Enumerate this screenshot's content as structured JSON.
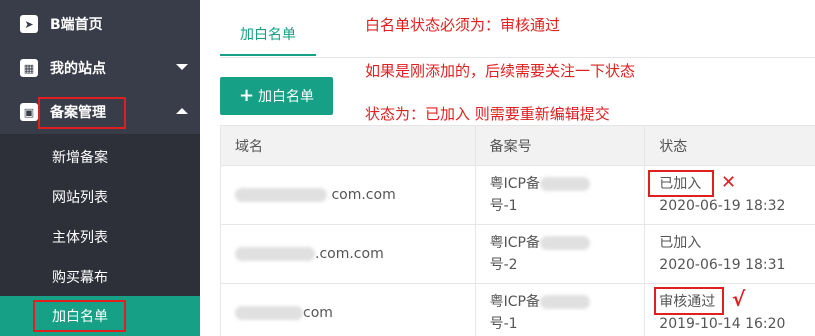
{
  "sidebar": {
    "items": [
      {
        "label": "B端首页",
        "icon": "send-icon"
      },
      {
        "label": "我的站点",
        "icon": "site-icon"
      },
      {
        "label": "备案管理",
        "icon": "gift-icon"
      }
    ],
    "sub_items": [
      "新增备案",
      "网站列表",
      "主体列表",
      "购买幕布",
      "加白名单"
    ]
  },
  "tab": {
    "label": "加白名单"
  },
  "add_button": {
    "label": "加白名单"
  },
  "notes": {
    "line1": "白名单状态必须为：审核通过",
    "line2": "如果是刚添加的，后续需要关注一下状态",
    "line3": "状态为：已加入 则需要重新编辑提交"
  },
  "table": {
    "headers": [
      "域名",
      "备案号",
      "状态"
    ],
    "rows": [
      {
        "domain_suffix": "com.com",
        "icp_prefix": "粤ICP备",
        "icp_suffix": "号-1",
        "status": "已加入",
        "time": "2020-06-19 18:32"
      },
      {
        "domain_suffix": ".com.com",
        "icp_prefix": "粤ICP备",
        "icp_suffix": "号-2",
        "status": "已加入",
        "time": "2020-06-19 18:31"
      },
      {
        "domain_suffix": "com",
        "icp_prefix": "粤ICP备",
        "icp_suffix": "号-1",
        "status": "审核通过",
        "time": "2019-10-14 16:20"
      }
    ]
  },
  "marks": {
    "wrong": "✕",
    "right": "√"
  },
  "colors": {
    "accent": "#16a085",
    "sidebar": "#393d49",
    "annotation": "#e02020"
  }
}
